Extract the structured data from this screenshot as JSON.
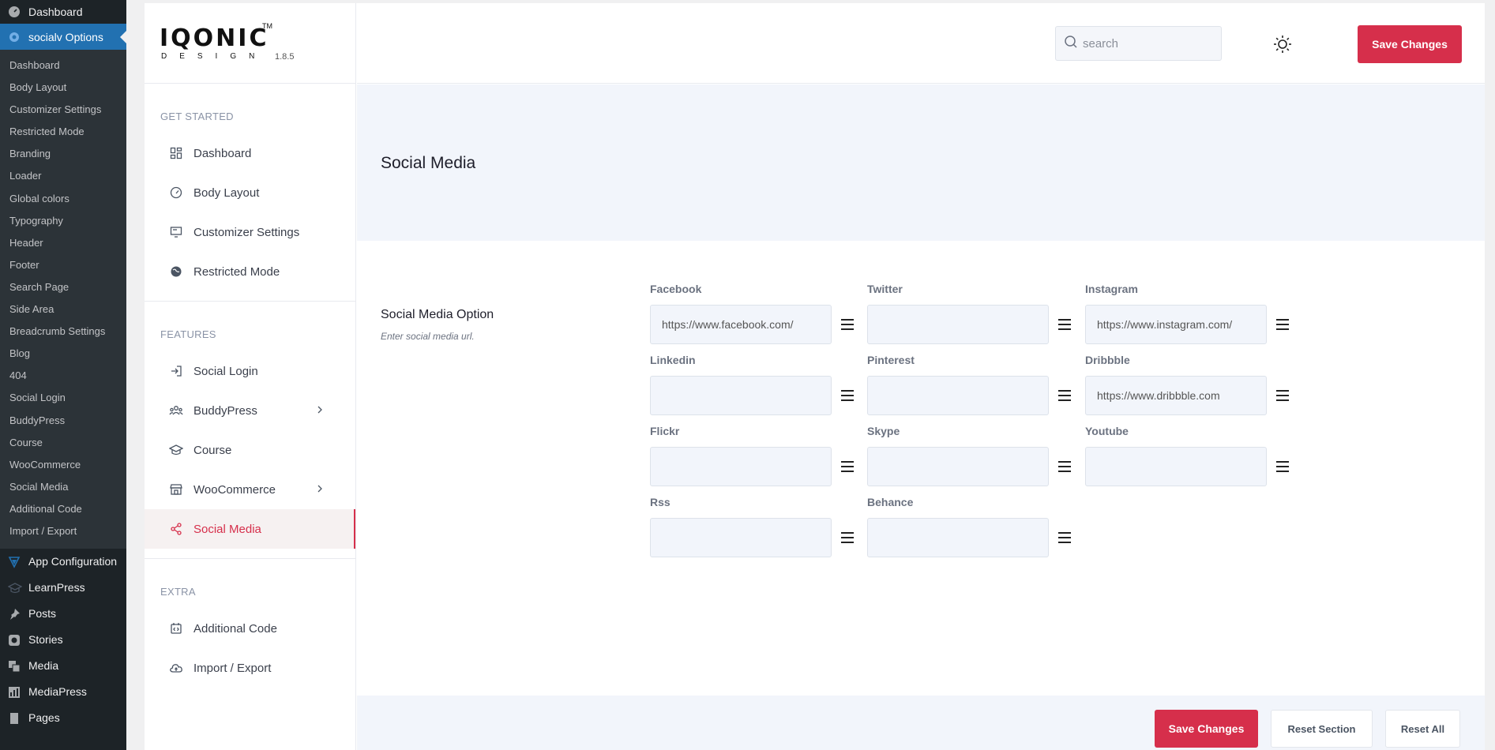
{
  "wp_sidebar": {
    "top_item": "Dashboard",
    "current_item": "socialv Options",
    "submenu": [
      "Dashboard",
      "Body Layout",
      "Customizer Settings",
      "Restricted Mode",
      "Branding",
      "Loader",
      "Global colors",
      "Typography",
      "Header",
      "Footer",
      "Search Page",
      "Side Area",
      "Breadcrumb Settings",
      "Blog",
      "404",
      "Social Login",
      "BuddyPress",
      "Course",
      "WooCommerce",
      "Social Media",
      "Additional Code",
      "Import / Export"
    ],
    "menu": [
      {
        "label": "App Configuration",
        "icon": "app-config-icon"
      },
      {
        "label": "LearnPress",
        "icon": "graduation-cap-icon"
      },
      {
        "label": "Posts",
        "icon": "pin-icon"
      },
      {
        "label": "Stories",
        "icon": "stories-icon"
      },
      {
        "label": "Media",
        "icon": "media-icon"
      },
      {
        "label": "MediaPress",
        "icon": "mediapress-icon"
      },
      {
        "label": "Pages",
        "icon": "pages-icon"
      }
    ]
  },
  "logo": {
    "brand": "IQONIC",
    "tm": "TM",
    "sub": "DESIGN",
    "version": "1.8.5"
  },
  "nav": {
    "get_started": {
      "heading": "GET STARTED",
      "items": [
        {
          "label": "Dashboard",
          "icon": "dashboard-icon"
        },
        {
          "label": "Body Layout",
          "icon": "gauge-icon"
        },
        {
          "label": "Customizer Settings",
          "icon": "monitor-icon"
        },
        {
          "label": "Restricted Mode",
          "icon": "globe-icon"
        }
      ]
    },
    "features": {
      "heading": "FEATURES",
      "items": [
        {
          "label": "Social Login",
          "icon": "login-icon"
        },
        {
          "label": "BuddyPress",
          "icon": "users-icon"
        },
        {
          "label": "Course",
          "icon": "graduation-cap-icon"
        },
        {
          "label": "WooCommerce",
          "icon": "store-icon"
        },
        {
          "label": "Social Media",
          "icon": "share-icon"
        }
      ]
    },
    "extra": {
      "heading": "EXTRA",
      "items": [
        {
          "label": "Additional Code",
          "icon": "code-icon"
        },
        {
          "label": "Import / Export",
          "icon": "cloud-icon"
        }
      ]
    }
  },
  "header": {
    "search_placeholder": "search",
    "save_label": "Save Changes"
  },
  "section": {
    "title": "Social Media",
    "option_title": "Social Media Option",
    "option_desc": "Enter social media url.",
    "fields": [
      {
        "label": "Facebook",
        "value": "https://www.facebook.com/"
      },
      {
        "label": "Twitter",
        "value": ""
      },
      {
        "label": "Instagram",
        "value": "https://www.instagram.com/"
      },
      {
        "label": "Linkedin",
        "value": ""
      },
      {
        "label": "Pinterest",
        "value": ""
      },
      {
        "label": "Dribbble",
        "value": "https://www.dribbble.com"
      },
      {
        "label": "Flickr",
        "value": ""
      },
      {
        "label": "Skype",
        "value": ""
      },
      {
        "label": "Youtube",
        "value": ""
      },
      {
        "label": "Rss",
        "value": ""
      },
      {
        "label": "Behance",
        "value": ""
      }
    ]
  },
  "footer": {
    "save_label": "Save Changes",
    "reset_section_label": "Reset Section",
    "reset_all_label": "Reset All"
  },
  "colors": {
    "accent": "#d62f4b",
    "wp_sidebar": "#1d2327",
    "wp_current": "#2271b1",
    "panel_bg": "#f2f5fb"
  }
}
